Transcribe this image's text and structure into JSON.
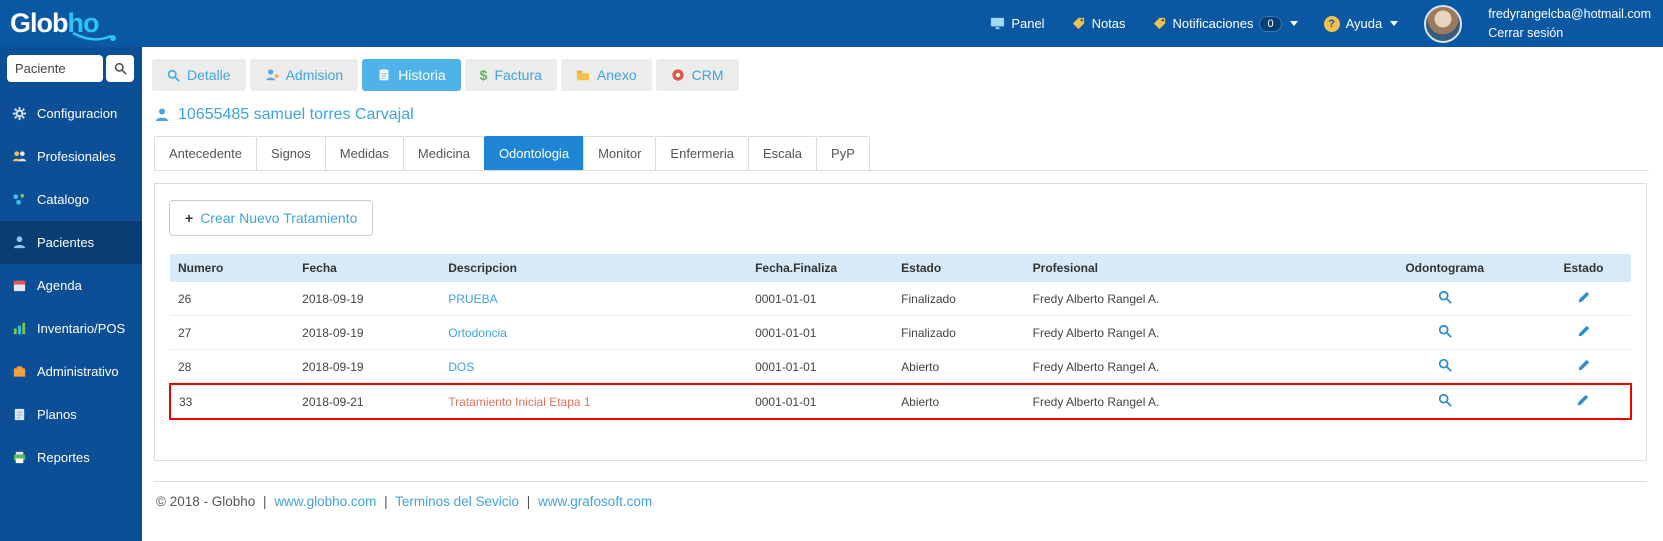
{
  "brand": {
    "part1": "Glob",
    "part2": "ho"
  },
  "icons": {
    "plus": "+",
    "dollar": "$",
    "question": "?"
  },
  "colors": {
    "topbar_bg": "#0a58a4",
    "sidebar_bg": "#0c4f97",
    "active_tab": "#4fb2e8",
    "active_subtab": "#1d85d4",
    "link_blue": "#3fa3dc",
    "highlight_red": "#ee0000",
    "highlight_link": "#e0745e",
    "table_header_bg": "#d8eaf8"
  },
  "topbar": {
    "panel": "Panel",
    "notas": "Notas",
    "notificaciones": "Notificaciones",
    "notificaciones_badge": "0",
    "ayuda": "Ayuda",
    "email": "fredyrangelcba@hotmail.com",
    "logout": "Cerrar sesión"
  },
  "sidebar": {
    "search_placeholder": "Paciente",
    "items": [
      {
        "label": "Configuracion"
      },
      {
        "label": "Profesionales"
      },
      {
        "label": "Catalogo"
      },
      {
        "label": "Pacientes"
      },
      {
        "label": "Agenda"
      },
      {
        "label": "Inventario/POS"
      },
      {
        "label": "Administrativo"
      },
      {
        "label": "Planos"
      },
      {
        "label": "Reportes"
      }
    ]
  },
  "main_tabs": [
    {
      "label": "Detalle"
    },
    {
      "label": "Admision"
    },
    {
      "label": "Historia"
    },
    {
      "label": "Factura"
    },
    {
      "label": "Anexo"
    },
    {
      "label": "CRM"
    }
  ],
  "patient_title": "10655485 samuel torres Carvajal",
  "sub_tabs": [
    {
      "label": "Antecedente"
    },
    {
      "label": "Signos"
    },
    {
      "label": "Medidas"
    },
    {
      "label": "Medicina"
    },
    {
      "label": "Odontologia"
    },
    {
      "label": "Monitor"
    },
    {
      "label": "Enfermeria"
    },
    {
      "label": "Escala"
    },
    {
      "label": "PyP"
    }
  ],
  "treatments": {
    "create_button": "Crear Nuevo Tratamiento",
    "headers": [
      "Numero",
      "Fecha",
      "Descripcion",
      "Fecha.Finaliza",
      "Estado",
      "Profesional",
      "Odontograma",
      "Estado"
    ],
    "rows": [
      {
        "numero": "26",
        "fecha": "2018-09-19",
        "descripcion": "PRUEBA",
        "fecha_finaliza": "0001-01-01",
        "estado": "Finalizado",
        "profesional": "Fredy Alberto Rangel A."
      },
      {
        "numero": "27",
        "fecha": "2018-09-19",
        "descripcion": "Ortodoncia",
        "fecha_finaliza": "0001-01-01",
        "estado": "Finalizado",
        "profesional": "Fredy Alberto Rangel A."
      },
      {
        "numero": "28",
        "fecha": "2018-09-19",
        "descripcion": "DOS",
        "fecha_finaliza": "0001-01-01",
        "estado": "Abierto",
        "profesional": "Fredy Alberto Rangel A."
      },
      {
        "numero": "33",
        "fecha": "2018-09-21",
        "descripcion": "Tratamiento Inicial Etapa 1",
        "fecha_finaliza": "0001-01-01",
        "estado": "Abierto",
        "profesional": "Fredy Alberto Rangel A."
      }
    ]
  },
  "footer": {
    "copyright": "© 2018 - Globho",
    "separator": "|",
    "links": [
      "www.globho.com",
      "Terminos del Sevicio",
      "www.grafosoft.com"
    ]
  }
}
